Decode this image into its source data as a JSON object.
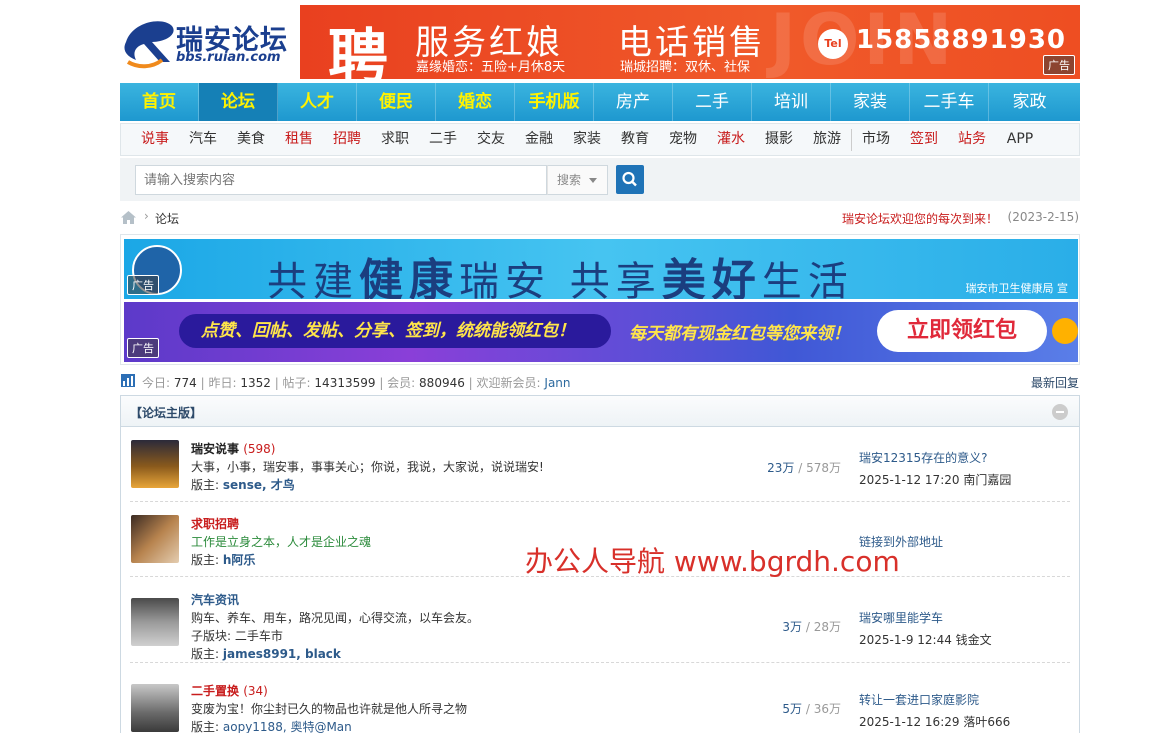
{
  "logo": {
    "name": "瑞安论坛",
    "url": "bbs.ruian.com"
  },
  "top_ad": {
    "big_char": "聘",
    "title1": "服务红娘",
    "title2": "电话销售",
    "sub1": "嘉缘婚恋：五险+月休8天",
    "sub2": "瑞城招聘：双休、社保",
    "tel_label": "Tel",
    "phone": "15858891930",
    "watermark": "JOIN US",
    "tag": "广告"
  },
  "nav": {
    "items": [
      {
        "label": "首页",
        "yellow": true
      },
      {
        "label": "论坛",
        "yellow": true,
        "active": true
      },
      {
        "label": "人才",
        "yellow": true
      },
      {
        "label": "便民",
        "yellow": true
      },
      {
        "label": "婚恋",
        "yellow": true
      },
      {
        "label": "手机版",
        "yellow": true
      },
      {
        "label": "房产"
      },
      {
        "label": "二手"
      },
      {
        "label": "培训"
      },
      {
        "label": "家装"
      },
      {
        "label": "二手车"
      },
      {
        "label": "家政"
      }
    ]
  },
  "subnav": {
    "items": [
      {
        "label": "说事",
        "red": true
      },
      {
        "label": "汽车"
      },
      {
        "label": "美食"
      },
      {
        "label": "租售",
        "red": true
      },
      {
        "label": "招聘",
        "red": true
      },
      {
        "label": "求职"
      },
      {
        "label": "二手"
      },
      {
        "label": "交友"
      },
      {
        "label": "金融"
      },
      {
        "label": "家装"
      },
      {
        "label": "教育"
      },
      {
        "label": "宠物"
      },
      {
        "label": "灌水",
        "red": true
      },
      {
        "label": "摄影"
      },
      {
        "label": "旅游"
      },
      {
        "label": "市场",
        "sep": true
      },
      {
        "label": "签到",
        "red": true
      },
      {
        "label": "站务",
        "red": true
      },
      {
        "label": "APP"
      }
    ]
  },
  "search": {
    "placeholder": "请输入搜索内容",
    "type": "搜索"
  },
  "breadcrumb": {
    "current": "论坛",
    "welcome": "瑞安论坛欢迎您的每次到来！",
    "date": "(2023-2-15)"
  },
  "banner1": {
    "text_a": "共建",
    "text_b": "健康",
    "text_c": "瑞安 共享",
    "text_d": "美好",
    "text_e": "生活",
    "org": "瑞安市卫生健康局 宣",
    "tag": "广告"
  },
  "banner2": {
    "pill": "点赞、回帖、发帖、分享、签到，统统能领红包！",
    "mid": "每天都有现金红包等您来领！",
    "button": "立即领红包",
    "tag": "广告"
  },
  "stats": {
    "today_label": "今日:",
    "today": "774",
    "yesterday_label": "昨日:",
    "yesterday": "1352",
    "posts_label": "帖子:",
    "posts": "14313599",
    "members_label": "会员:",
    "members": "880946",
    "welcome_label": "欢迎新会员:",
    "newest": "Jann",
    "latest": "最新回复"
  },
  "forum": {
    "title": "【论坛主版】",
    "boards": [
      {
        "name": "瑞安说事",
        "count": "(598)",
        "desc": "大事，小事，瑞安事，事事关心；你说，我说，大家说，说说瑞安!",
        "mod_label": "版主:",
        "mods": "sense, 才鸟",
        "threads": "23万",
        "posts": "578万",
        "last_title": "瑞安12315存在的意义?",
        "last_time": "2025-1-12 17:20 南门嘉园"
      },
      {
        "name": "求职招聘",
        "count": "",
        "desc": "工作是立身之本，人才是企业之魂",
        "mod_label": "版主:",
        "mods": "h阿乐",
        "threads": "",
        "posts": "",
        "last_title": "链接到外部地址",
        "last_time": ""
      },
      {
        "name": "汽车资讯",
        "count": "",
        "desc": "购车、养车、用车，路况见闻，心得交流，以车会友。",
        "sub_label": "子版块:",
        "sub": "二手车市",
        "mod_label": "版主:",
        "mods": "james8991, black",
        "threads": "3万",
        "posts": "28万",
        "last_title": "瑞安哪里能学车",
        "last_time": "2025-1-9 12:44 钱金文"
      },
      {
        "name": "二手置换",
        "count": "(34)",
        "desc": "变废为宝！你尘封已久的物品也许就是他人所寻之物",
        "mod_label": "版主:",
        "mods": "aopy1188, 奥特@Man",
        "threads": "5万",
        "posts": "36万",
        "last_title": "转让一套进口家庭影院",
        "last_time": "2025-1-12 16:29 落叶666"
      }
    ]
  },
  "overlay": {
    "watermark": "办公人导航 www.bgrdh.com"
  }
}
